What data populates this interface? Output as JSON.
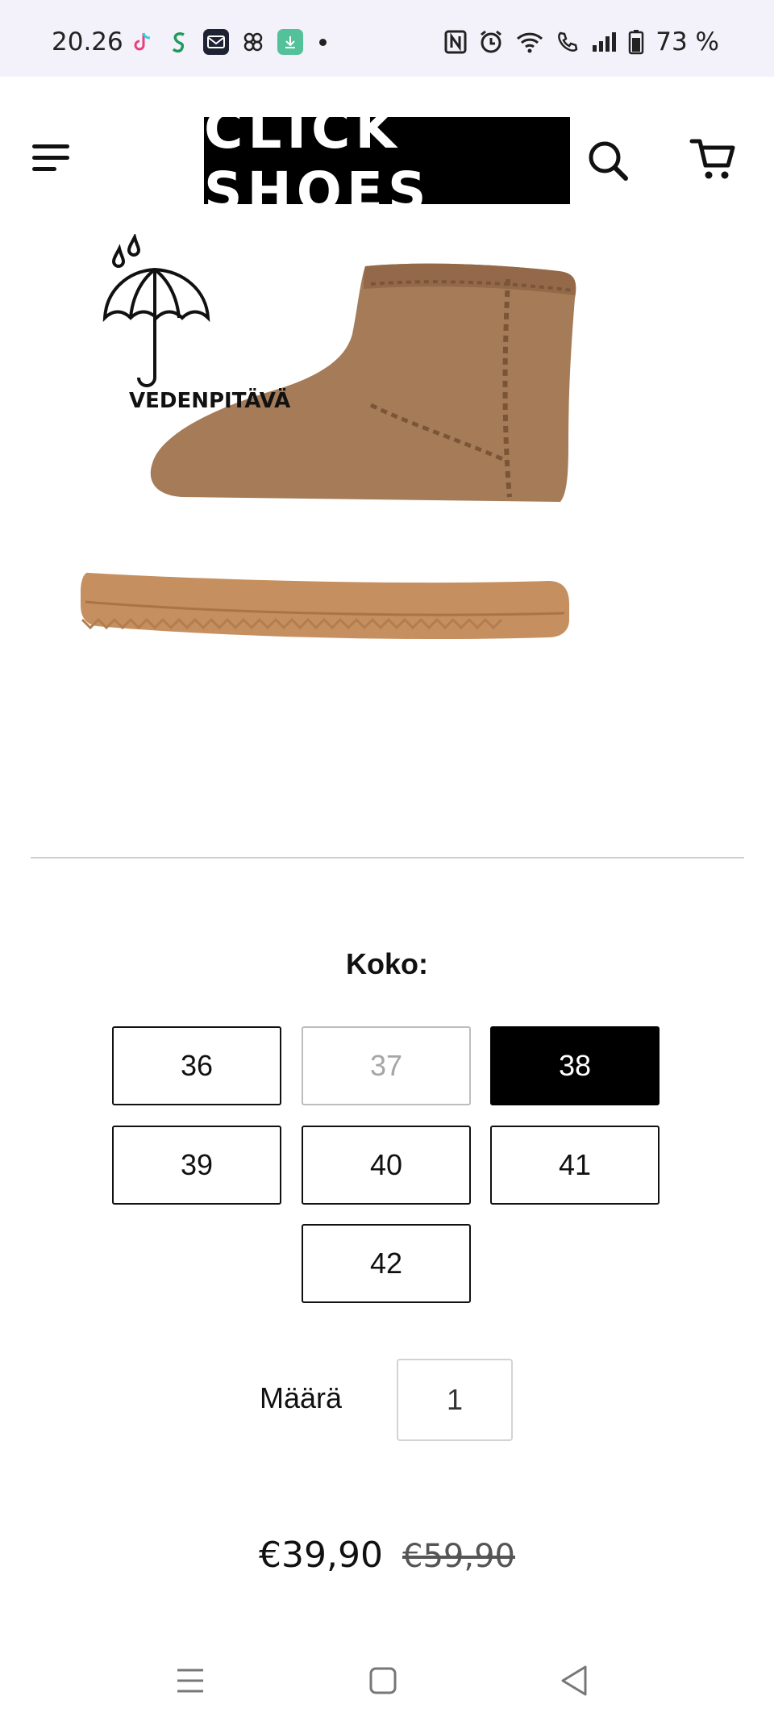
{
  "status_bar": {
    "time": "20.26",
    "battery": "73 %",
    "apps": [
      "tiktok-icon",
      "s-app-icon",
      "mail-icon",
      "pinwheel-icon",
      "download-icon"
    ]
  },
  "header": {
    "logo_text": "CLICK SHOES"
  },
  "product": {
    "badge_label": "VEDENPITÄVÄ",
    "size_label": "Koko:",
    "sizes": [
      {
        "label": "36",
        "state": "available"
      },
      {
        "label": "37",
        "state": "unavailable"
      },
      {
        "label": "38",
        "state": "selected"
      },
      {
        "label": "39",
        "state": "available"
      },
      {
        "label": "40",
        "state": "available"
      },
      {
        "label": "41",
        "state": "available"
      },
      {
        "label": "42",
        "state": "available"
      }
    ],
    "quantity_label": "Määrä",
    "quantity_value": "1",
    "price": "€39,90",
    "compare_price": "€59,90"
  },
  "colors": {
    "boot": "#a57b58",
    "sole": "#c68f5f",
    "selected": "#000000"
  }
}
